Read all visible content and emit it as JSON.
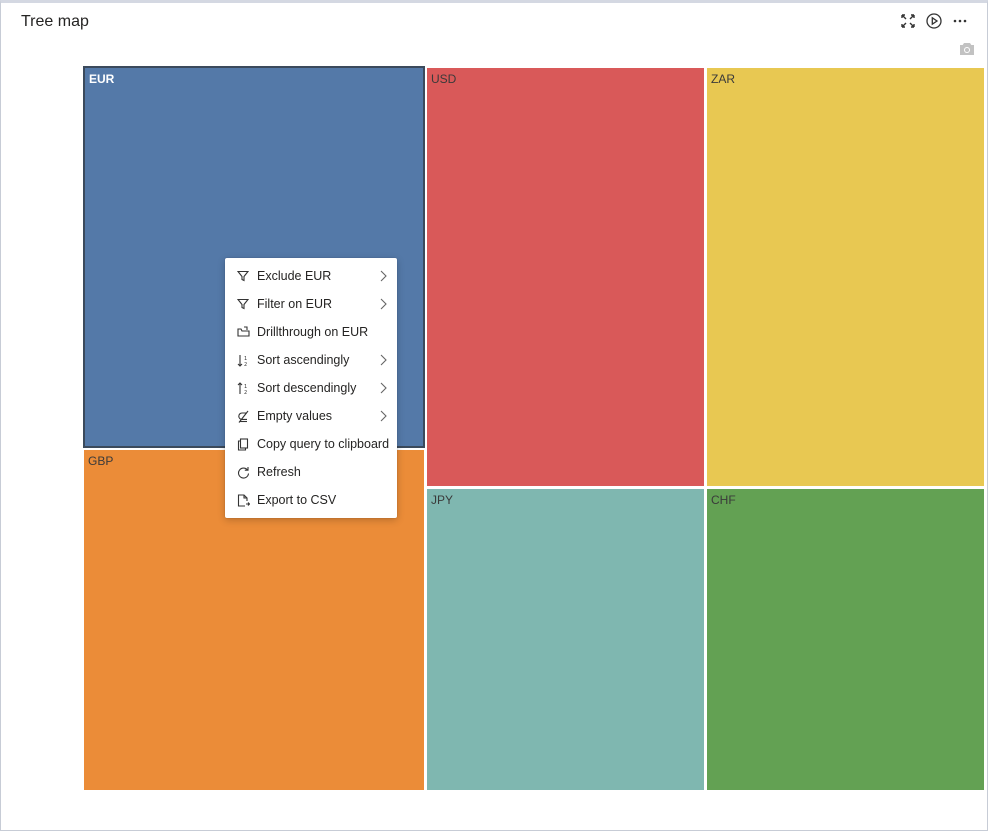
{
  "visual": {
    "title": "Tree map",
    "toolbar": {
      "icons": [
        "focus-mode-icon",
        "play-icon",
        "more-options-icon"
      ]
    },
    "camera_icon": "camera-icon"
  },
  "chart_data": {
    "type": "treemap",
    "title": "Tree map",
    "items": [
      {
        "label": "EUR",
        "color": "#5479a8",
        "text_color": "#ffffff"
      },
      {
        "label": "GBP",
        "color": "#eb8c38",
        "text_color": "#3a3a3a"
      },
      {
        "label": "USD",
        "color": "#d95959",
        "text_color": "#3a3a3a"
      },
      {
        "label": "JPY",
        "color": "#7fb7b0",
        "text_color": "#3a3a3a"
      },
      {
        "label": "ZAR",
        "color": "#e8c852",
        "text_color": "#3a3a3a"
      },
      {
        "label": "CHF",
        "color": "#63a153",
        "text_color": "#3a3a3a"
      }
    ],
    "selected": "EUR"
  },
  "context_menu": {
    "items": [
      {
        "label": "Exclude EUR",
        "icon": "funnel-icon",
        "submenu": true
      },
      {
        "label": "Filter on EUR",
        "icon": "funnel-icon",
        "submenu": true
      },
      {
        "label": "Drillthrough on EUR",
        "icon": "drillthrough-icon",
        "submenu": false
      },
      {
        "label": "Sort ascendingly",
        "icon": "sort-ascending-icon",
        "submenu": true
      },
      {
        "label": "Sort descendingly",
        "icon": "sort-descending-icon",
        "submenu": true
      },
      {
        "label": "Empty values",
        "icon": "not-subset-icon",
        "submenu": true
      },
      {
        "label": "Copy query to clipboard",
        "icon": "copy-icon",
        "submenu": false
      },
      {
        "label": "Refresh",
        "icon": "refresh-icon",
        "submenu": false
      },
      {
        "label": "Export to CSV",
        "icon": "export-file-icon",
        "submenu": false
      }
    ]
  }
}
